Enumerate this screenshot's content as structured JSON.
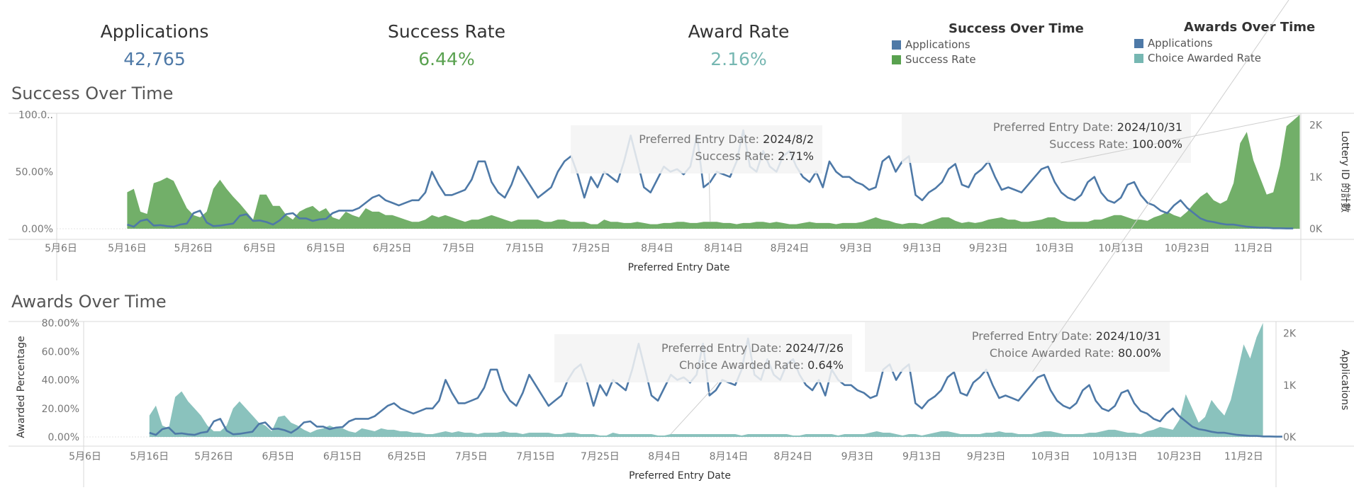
{
  "kpis": [
    {
      "title": "Applications",
      "value": "42,765",
      "color": "#4e79a7"
    },
    {
      "title": "Success Rate",
      "value": "6.44%",
      "color": "#59a14f"
    },
    {
      "title": "Award Rate",
      "value": "2.16%",
      "color": "#76b7b2"
    }
  ],
  "legends": [
    {
      "title": "Success Over Time",
      "items": [
        {
          "label": "Applications",
          "color": "#4e79a7"
        },
        {
          "label": "Success Rate",
          "color": "#59a14f"
        }
      ]
    },
    {
      "title": "Awards Over Time",
      "items": [
        {
          "label": "Applications",
          "color": "#4e79a7"
        },
        {
          "label": "Choice Awarded Rate",
          "color": "#76b7b2"
        }
      ]
    }
  ],
  "chart_data": [
    {
      "type": "area",
      "title": "Success Over Time",
      "xlabel": "Preferred Entry Date",
      "ylabel": "",
      "y2label": "Lottery ID 的計數",
      "x_ticks": [
        "5月6日",
        "5月16日",
        "5月26日",
        "6月5日",
        "6月15日",
        "6月25日",
        "7月5日",
        "7月15日",
        "7月25日",
        "8月4日",
        "8月14日",
        "8月24日",
        "9月3日",
        "9月13日",
        "9月23日",
        "10月3日",
        "10月13日",
        "10月23日",
        "11月2日"
      ],
      "y_ticks": [
        "0.00%",
        "50.00%",
        "100.0.."
      ],
      "y2_ticks": [
        "0K",
        "1K",
        "2K"
      ],
      "ylim": [
        0,
        100
      ],
      "y2lim": [
        0,
        2200
      ],
      "x_start": "2024-05-06",
      "series": [
        {
          "name": "Success Rate",
          "kind": "area",
          "color": "#59a14f",
          "values": [
            32,
            35,
            15,
            13,
            40,
            42,
            45,
            42,
            30,
            18,
            12,
            10,
            15,
            35,
            43,
            35,
            28,
            22,
            15,
            8,
            30,
            30,
            20,
            20,
            12,
            8,
            15,
            18,
            20,
            15,
            18,
            10,
            8,
            15,
            12,
            10,
            18,
            15,
            15,
            12,
            12,
            10,
            8,
            6,
            6,
            8,
            12,
            10,
            12,
            10,
            8,
            6,
            8,
            8,
            10,
            12,
            10,
            8,
            6,
            8,
            8,
            8,
            8,
            6,
            6,
            8,
            8,
            6,
            6,
            6,
            4,
            4,
            8,
            6,
            6,
            5,
            5,
            6,
            5,
            4,
            4,
            5,
            5,
            6,
            6,
            5,
            5,
            6,
            6,
            6,
            5,
            5,
            4,
            5,
            5,
            6,
            6,
            5,
            6,
            5,
            4,
            4,
            5,
            6,
            5,
            5,
            5,
            4,
            5,
            5,
            5,
            6,
            8,
            10,
            8,
            7,
            5,
            4,
            5,
            5,
            4,
            6,
            8,
            10,
            10,
            7,
            5,
            6,
            5,
            6,
            8,
            9,
            10,
            8,
            8,
            6,
            6,
            7,
            8,
            10,
            10,
            7,
            6,
            6,
            6,
            6,
            8,
            8,
            10,
            12,
            12,
            10,
            8,
            8,
            7,
            10,
            12,
            15,
            12,
            10,
            15,
            22,
            28,
            32,
            25,
            22,
            25,
            40,
            75,
            85,
            60,
            45,
            30,
            32,
            55,
            90,
            95,
            100
          ]
        },
        {
          "name": "Applications",
          "kind": "line",
          "color": "#4e79a7",
          "axis": "right",
          "values": [
            80,
            40,
            150,
            180,
            60,
            70,
            50,
            40,
            80,
            100,
            300,
            350,
            120,
            50,
            60,
            80,
            100,
            250,
            280,
            150,
            160,
            130,
            80,
            160,
            280,
            300,
            200,
            200,
            150,
            180,
            190,
            300,
            350,
            350,
            350,
            400,
            500,
            600,
            650,
            550,
            500,
            450,
            500,
            550,
            550,
            700,
            1100,
            850,
            650,
            650,
            700,
            750,
            950,
            1300,
            1300,
            900,
            700,
            600,
            850,
            1200,
            1000,
            800,
            600,
            700,
            800,
            1100,
            1300,
            1400,
            1050,
            600,
            1000,
            800,
            1100,
            1000,
            900,
            1300,
            1800,
            1300,
            800,
            700,
            950,
            1200,
            1100,
            1150,
            1050,
            1200,
            1800,
            800,
            900,
            1100,
            1050,
            1000,
            1300,
            1900,
            1200,
            1100,
            1500,
            1200,
            1100,
            1400,
            1500,
            1200,
            1000,
            900,
            1100,
            800,
            1300,
            1100,
            1000,
            1000,
            900,
            850,
            750,
            800,
            1300,
            1400,
            1100,
            1300,
            1400,
            650,
            550,
            700,
            780,
            900,
            1150,
            1250,
            850,
            800,
            1050,
            1150,
            1300,
            1000,
            750,
            800,
            750,
            700,
            850,
            1000,
            1150,
            1200,
            900,
            700,
            600,
            550,
            650,
            900,
            1000,
            700,
            550,
            500,
            600,
            850,
            900,
            650,
            500,
            450,
            350,
            300,
            450,
            550,
            400,
            300,
            200,
            150,
            130,
            100,
            80,
            80,
            60,
            40,
            30,
            20,
            20,
            10,
            10,
            5,
            5
          ]
        }
      ],
      "tooltips": [
        {
          "lines": [
            {
              "label": "Preferred Entry Date:",
              "value": "2024/8/2"
            },
            {
              "label": "Success Rate:",
              "value": "2.71%"
            }
          ]
        },
        {
          "lines": [
            {
              "label": "Preferred Entry Date:",
              "value": "2024/10/31"
            },
            {
              "label": "Success Rate:",
              "value": "100.00%"
            }
          ]
        }
      ]
    },
    {
      "type": "area",
      "title": "Awards Over Time",
      "xlabel": "Preferred Entry Date",
      "ylabel": "Awarded Percentage",
      "y2label": "Applications",
      "x_ticks": [
        "5月6日",
        "5月16日",
        "5月26日",
        "6月5日",
        "6月15日",
        "6月25日",
        "7月5日",
        "7月15日",
        "7月25日",
        "8月4日",
        "8月14日",
        "8月24日",
        "9月3日",
        "9月13日",
        "9月23日",
        "10月3日",
        "10月13日",
        "10月23日",
        "11月2日"
      ],
      "y_ticks": [
        "0.00%",
        "20.00%",
        "40.00%",
        "60.00%",
        "80.00%"
      ],
      "y2_ticks": [
        "0K",
        "1K",
        "2K"
      ],
      "ylim": [
        0,
        80
      ],
      "y2lim": [
        0,
        2200
      ],
      "x_start": "2024-05-06",
      "series": [
        {
          "name": "Choice Awarded Rate",
          "kind": "area",
          "color": "#76b7b2",
          "values": [
            15,
            22,
            8,
            6,
            28,
            32,
            25,
            20,
            15,
            8,
            4,
            4,
            8,
            20,
            25,
            20,
            15,
            10,
            8,
            4,
            14,
            15,
            10,
            8,
            5,
            3,
            5,
            6,
            8,
            6,
            6,
            4,
            3,
            6,
            5,
            4,
            6,
            5,
            5,
            4,
            4,
            3,
            3,
            2,
            2,
            3,
            4,
            3,
            4,
            3,
            3,
            2,
            3,
            3,
            3,
            4,
            3,
            3,
            2,
            3,
            3,
            3,
            3,
            2,
            2,
            3,
            3,
            2,
            2,
            2,
            1,
            1,
            3,
            2,
            2,
            2,
            2,
            2,
            2,
            1,
            1,
            2,
            2,
            2,
            2,
            2,
            2,
            2,
            2,
            2,
            2,
            2,
            1,
            2,
            2,
            2,
            2,
            2,
            2,
            2,
            1,
            1,
            2,
            2,
            2,
            2,
            2,
            1,
            2,
            2,
            2,
            2,
            3,
            4,
            3,
            3,
            2,
            1,
            2,
            2,
            1,
            2,
            3,
            4,
            4,
            3,
            2,
            2,
            2,
            2,
            3,
            3,
            4,
            3,
            3,
            2,
            2,
            2,
            3,
            4,
            4,
            3,
            2,
            2,
            2,
            2,
            3,
            3,
            4,
            5,
            5,
            4,
            3,
            3,
            2,
            4,
            5,
            7,
            6,
            5,
            12,
            30,
            20,
            10,
            14,
            26,
            20,
            15,
            26,
            45,
            65,
            55,
            70,
            80
          ]
        },
        {
          "name": "Applications",
          "kind": "line",
          "color": "#4e79a7",
          "axis": "right",
          "values": [
            80,
            40,
            150,
            180,
            60,
            70,
            50,
            40,
            80,
            100,
            300,
            350,
            120,
            50,
            60,
            80,
            100,
            250,
            280,
            150,
            160,
            130,
            80,
            160,
            280,
            300,
            200,
            200,
            150,
            180,
            190,
            300,
            350,
            350,
            350,
            400,
            500,
            600,
            650,
            550,
            500,
            450,
            500,
            550,
            550,
            700,
            1100,
            850,
            650,
            650,
            700,
            750,
            950,
            1300,
            1300,
            900,
            700,
            600,
            850,
            1200,
            1000,
            800,
            600,
            700,
            800,
            1100,
            1300,
            1400,
            1050,
            600,
            1000,
            800,
            1100,
            1000,
            900,
            1300,
            1800,
            1300,
            800,
            700,
            950,
            1200,
            1100,
            1150,
            1050,
            1200,
            1800,
            800,
            900,
            1100,
            1050,
            1000,
            1300,
            1900,
            1200,
            1100,
            1500,
            1200,
            1100,
            1400,
            1500,
            1200,
            1000,
            900,
            1100,
            800,
            1300,
            1100,
            1000,
            1000,
            900,
            850,
            750,
            800,
            1300,
            1400,
            1100,
            1300,
            1400,
            650,
            550,
            700,
            780,
            900,
            1150,
            1250,
            850,
            800,
            1050,
            1150,
            1300,
            1000,
            750,
            800,
            750,
            700,
            850,
            1000,
            1150,
            1200,
            900,
            700,
            600,
            550,
            650,
            900,
            1000,
            700,
            550,
            500,
            600,
            850,
            900,
            650,
            500,
            450,
            350,
            300,
            450,
            550,
            400,
            300,
            200,
            150,
            130,
            100,
            80,
            80,
            60,
            40,
            30,
            20,
            20,
            10,
            10,
            5,
            5
          ]
        }
      ],
      "tooltips": [
        {
          "lines": [
            {
              "label": "Preferred Entry Date:",
              "value": "2024/7/26"
            },
            {
              "label": "Choice Awarded Rate:",
              "value": "0.64%"
            }
          ]
        },
        {
          "lines": [
            {
              "label": "Preferred Entry Date:",
              "value": "2024/10/31"
            },
            {
              "label": "Choice Awarded Rate:",
              "value": "80.00%"
            }
          ]
        }
      ]
    }
  ]
}
